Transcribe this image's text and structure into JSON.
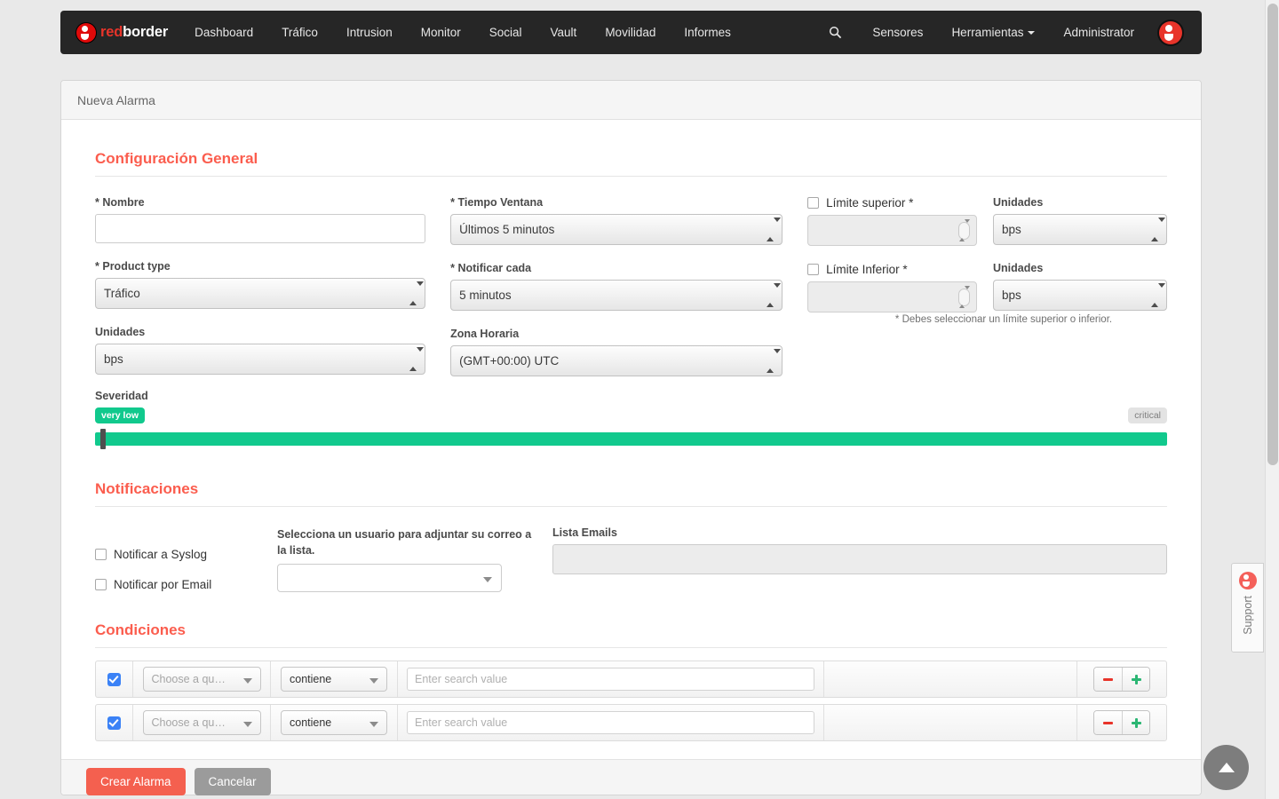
{
  "navbar": {
    "brand": {
      "red": "red",
      "white": "border"
    },
    "links": [
      "Dashboard",
      "Tráfico",
      "Intrusion",
      "Monitor",
      "Social",
      "Vault",
      "Movilidad",
      "Informes"
    ],
    "search_icon": "search-icon",
    "right_links": [
      "Sensores",
      "Herramientas"
    ],
    "user": "Administrator"
  },
  "panel": {
    "title": "Nueva Alarma"
  },
  "general": {
    "section_title": "Configuración General",
    "nombre_label": "Nombre",
    "nombre_required": "*",
    "nombre_value": "",
    "product_type_label": "Product type",
    "product_type_required": "*",
    "product_type_value": "Tráfico",
    "unidades_label": "Unidades",
    "unidades_value": "bps",
    "tiempo_ventana_label": "Tiempo Ventana",
    "tiempo_ventana_required": "*",
    "tiempo_ventana_value": "Últimos 5 minutos",
    "notificar_cada_label": "Notificar cada",
    "notificar_cada_required": "*",
    "notificar_cada_value": "5 minutos",
    "zona_horaria_label": "Zona Horaria",
    "zona_horaria_value": "(GMT+00:00) UTC",
    "limite_superior_label": "Límite superior *",
    "limite_superior_value": "",
    "limite_inferior_label": "Límite Inferior *",
    "limite_inferior_value": "",
    "unidades_sup_label": "Unidades",
    "unidades_sup_value": "bps",
    "unidades_inf_label": "Unidades",
    "unidades_inf_value": "bps",
    "limit_note": "* Debes seleccionar un límite superior o inferior.",
    "severidad_label": "Severidad",
    "severity_low_badge": "very low",
    "severity_high_badge": "critical"
  },
  "notificaciones": {
    "section_title": "Notificaciones",
    "syslog_label": "Notificar a Syslog",
    "email_label": "Notificar por Email",
    "user_select_label": "Selecciona un usuario para adjuntar su correo a la lista.",
    "user_select_value": "",
    "email_list_label": "Lista Emails",
    "email_list_value": ""
  },
  "condiciones": {
    "section_title": "Condiciones",
    "rows": [
      {
        "enabled": true,
        "field": "Choose a qu…",
        "operator": "contiene",
        "value": "",
        "value_placeholder": "Enter search value"
      },
      {
        "enabled": true,
        "field": "Choose a qu…",
        "operator": "contiene",
        "value": "",
        "value_placeholder": "Enter search value"
      }
    ]
  },
  "footer": {
    "submit_label": "Crear Alarma",
    "cancel_label": "Cancelar"
  },
  "support": {
    "label": "Support"
  },
  "colors": {
    "accent_red": "#fb5d4e",
    "navbar_bg": "#262626",
    "severity_green": "#11c98d",
    "checkbox_blue": "#3b82f6",
    "page_bg": "#e9e9e9"
  }
}
